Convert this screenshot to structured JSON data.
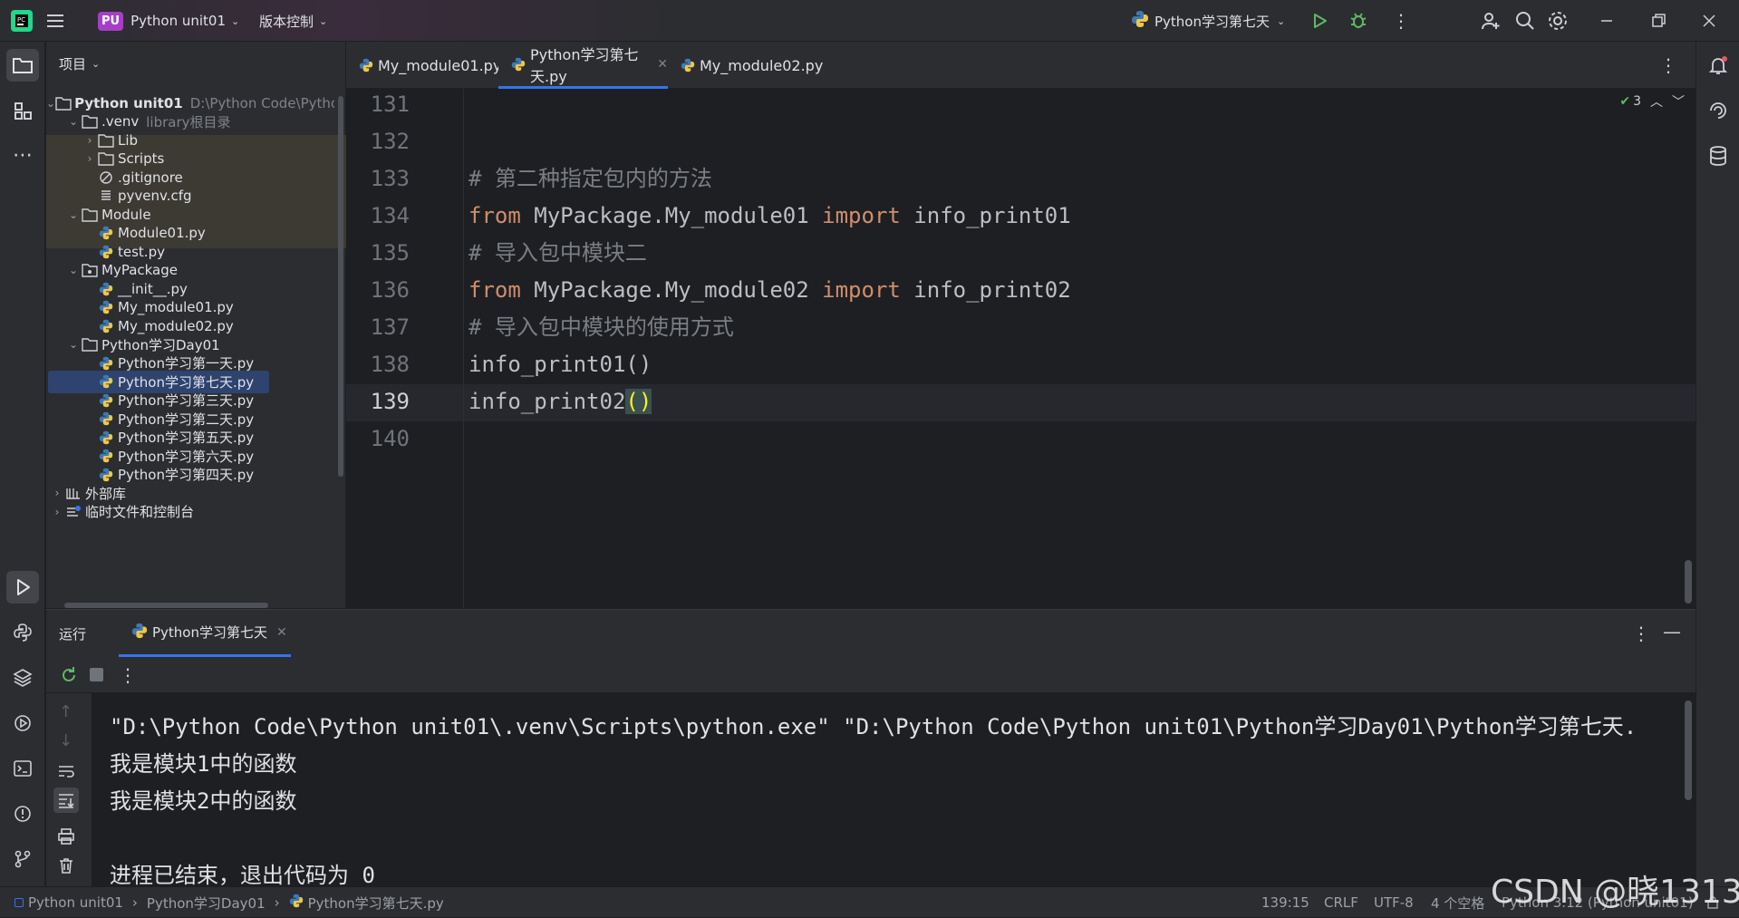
{
  "titlebar": {
    "project_badge": "PU",
    "project_name": "Python unit01",
    "vcs_menu": "版本控制",
    "run_config": "Python学习第七天"
  },
  "project_panel": {
    "title": "项目",
    "tree": [
      {
        "label": "Python unit01",
        "hint": "D:\\Python Code\\Pytho",
        "type": "folder",
        "expanded": true,
        "depth": 0,
        "bold": true
      },
      {
        "label": ".venv",
        "hint": "library根目录",
        "type": "folder",
        "expanded": true,
        "depth": 1
      },
      {
        "label": "Lib",
        "type": "folder",
        "expanded": false,
        "depth": 2
      },
      {
        "label": "Scripts",
        "type": "folder",
        "expanded": false,
        "depth": 2
      },
      {
        "label": ".gitignore",
        "type": "ignore",
        "depth": 2
      },
      {
        "label": "pyvenv.cfg",
        "type": "cfg",
        "depth": 2
      },
      {
        "label": "Module",
        "type": "folder",
        "expanded": true,
        "depth": 1
      },
      {
        "label": "Module01.py",
        "type": "py",
        "depth": 2
      },
      {
        "label": "test.py",
        "type": "py",
        "depth": 2
      },
      {
        "label": "MyPackage",
        "type": "package",
        "expanded": true,
        "depth": 1
      },
      {
        "label": "__init__.py",
        "type": "py",
        "depth": 2
      },
      {
        "label": "My_module01.py",
        "type": "py",
        "depth": 2
      },
      {
        "label": "My_module02.py",
        "type": "py",
        "depth": 2
      },
      {
        "label": "Python学习Day01",
        "type": "folder",
        "expanded": true,
        "depth": 1
      },
      {
        "label": "Python学习第一天.py",
        "type": "py",
        "depth": 2
      },
      {
        "label": "Python学习第七天.py",
        "type": "py",
        "depth": 2,
        "selected": true
      },
      {
        "label": "Python学习第三天.py",
        "type": "py",
        "depth": 2
      },
      {
        "label": "Python学习第二天.py",
        "type": "py",
        "depth": 2
      },
      {
        "label": "Python学习第五天.py",
        "type": "py",
        "depth": 2
      },
      {
        "label": "Python学习第六天.py",
        "type": "py",
        "depth": 2
      },
      {
        "label": "Python学习第四天.py",
        "type": "py",
        "depth": 2
      },
      {
        "label": "外部库",
        "type": "lib",
        "expanded": false,
        "depth": 0
      },
      {
        "label": "临时文件和控制台",
        "type": "scratch",
        "expanded": false,
        "depth": 0
      }
    ]
  },
  "editor": {
    "tabs": [
      {
        "label": "My_module01.py",
        "active": false
      },
      {
        "label": "Python学习第七天.py",
        "active": true
      },
      {
        "label": "My_module02.py",
        "active": false
      }
    ],
    "inspection_count": "3",
    "lines": [
      {
        "num": "131",
        "tokens": []
      },
      {
        "num": "132",
        "tokens": []
      },
      {
        "num": "133",
        "tokens": [
          {
            "t": "# 第二种指定包内的方法",
            "c": "cmt"
          }
        ]
      },
      {
        "num": "134",
        "tokens": [
          {
            "t": "from",
            "c": "kw"
          },
          {
            "t": " MyPackage.My_module01 ",
            "c": ""
          },
          {
            "t": "import",
            "c": "kw"
          },
          {
            "t": " info_print01",
            "c": ""
          }
        ]
      },
      {
        "num": "135",
        "tokens": [
          {
            "t": "# 导入包中模块二",
            "c": "cmt"
          }
        ]
      },
      {
        "num": "136",
        "tokens": [
          {
            "t": "from",
            "c": "kw"
          },
          {
            "t": " MyPackage.My_module02 ",
            "c": ""
          },
          {
            "t": "import",
            "c": "kw"
          },
          {
            "t": " info_print02",
            "c": ""
          }
        ]
      },
      {
        "num": "137",
        "tokens": [
          {
            "t": "# 导入包中模块的使用方式",
            "c": "cmt"
          }
        ]
      },
      {
        "num": "138",
        "tokens": [
          {
            "t": "info_print01()",
            "c": ""
          }
        ]
      },
      {
        "num": "139",
        "tokens": [
          {
            "t": "info_print02",
            "c": ""
          },
          {
            "t": "()",
            "c": "brace"
          }
        ]
      },
      {
        "num": "140",
        "tokens": []
      }
    ]
  },
  "run_panel": {
    "title": "运行",
    "tab_label": "Python学习第七天",
    "output": [
      "\"D:\\Python Code\\Python unit01\\.venv\\Scripts\\python.exe\" \"D:\\Python Code\\Python unit01\\Python学习Day01\\Python学习第七天.",
      "我是模块1中的函数",
      "我是模块2中的函数",
      "",
      "进程已结束，退出代码为 0"
    ]
  },
  "statusbar": {
    "crumbs": [
      "Python unit01",
      "Python学习Day01",
      "Python学习第七天.py"
    ],
    "position": "139:15",
    "line_sep": "CRLF",
    "encoding": "UTF-8",
    "indent": "4 个空格",
    "interpreter": "Python 3.12 (Python unit01)"
  },
  "watermark": "CSDN @晓1313",
  "colors": {
    "keyword": "#cf8e6d",
    "comment": "#7a7e85",
    "selection": "#2e436e",
    "accent": "#3574f0",
    "run_green": "#5fb865"
  }
}
